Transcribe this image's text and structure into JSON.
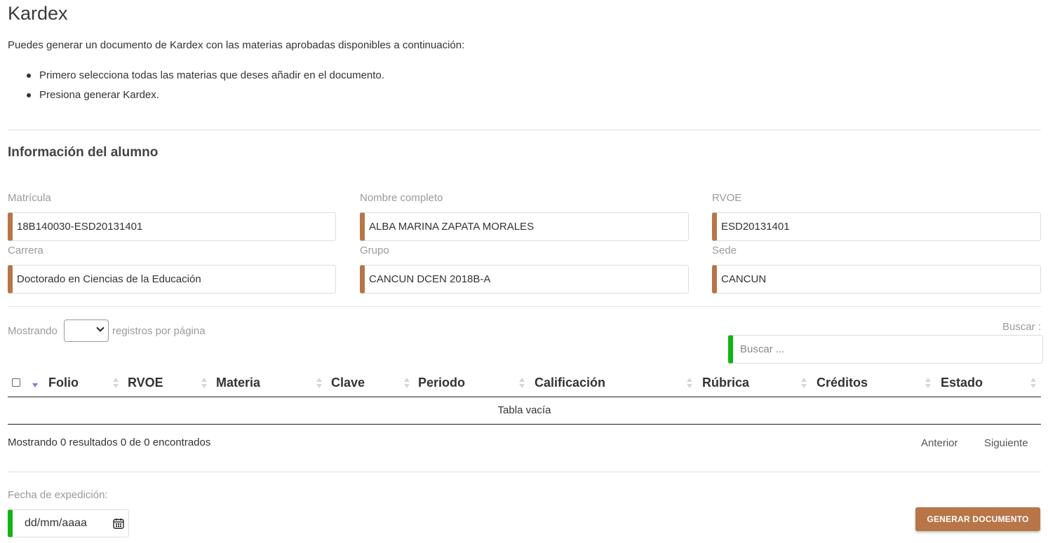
{
  "header": {
    "title": "Kardex",
    "intro": "Puedes generar un documento de Kardex con las materias aprobadas disponibles a continuación:",
    "steps": [
      "Primero selecciona todas las materias que deses añadir en el documento.",
      "Presiona generar Kardex."
    ]
  },
  "student": {
    "section_title": "Información del alumno",
    "fields": [
      {
        "label": "Matrícula",
        "value": "18B140030-ESD20131401"
      },
      {
        "label": "Nombre completo",
        "value": "ALBA MARINA ZAPATA MORALES"
      },
      {
        "label": "RVOE",
        "value": "ESD20131401"
      },
      {
        "label": "Carrera",
        "value": "Doctorado en Ciencias de la Educación"
      },
      {
        "label": "Grupo",
        "value": "CANCUN DCEN 2018B-A"
      },
      {
        "label": "Sede",
        "value": "CANCUN"
      }
    ],
    "accent_color": "#b87547"
  },
  "table": {
    "length_prefix": "Mostrando",
    "length_suffix": "registros por página",
    "search_label": "Buscar :",
    "search_placeholder": "Buscar ...",
    "columns": [
      "Folio",
      "RVOE",
      "Materia",
      "Clave",
      "Periodo",
      "Calificación",
      "Rúbrica",
      "Créditos",
      "Estado"
    ],
    "empty_text": "Tabla vacía",
    "info": "Mostrando 0 resultados 0 de 0 encontrados",
    "prev": "Anterior",
    "next": "Siguiente",
    "search_accent": "#12b312"
  },
  "footer": {
    "date_label": "Fecha de expedición:",
    "date_placeholder": "dd/mm/aaaa",
    "generate_button": "GENERAR DOCUMENTO",
    "button_color": "#b87547"
  },
  "icons": [
    "checkbox-icon",
    "sort-icon",
    "chevron-down-icon",
    "calendar-icon"
  ]
}
